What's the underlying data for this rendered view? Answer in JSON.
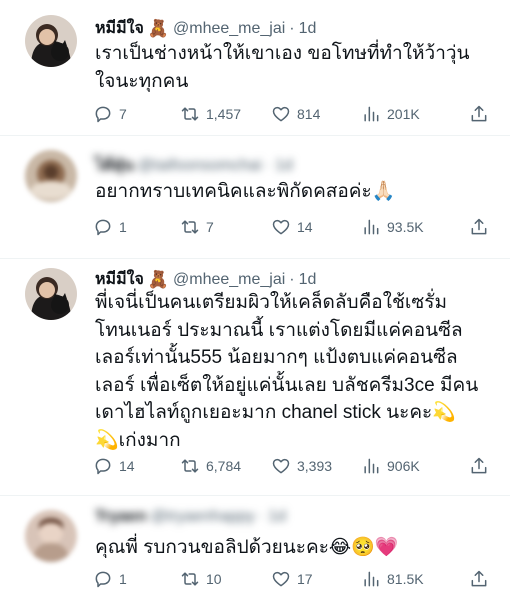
{
  "tweets": [
    {
      "name": "หมีมีใจ",
      "name_emoji": "🧸",
      "handle": "@mhee_me_jai",
      "dot": "·",
      "time": "1d",
      "lines": [
        "เราเป็นช่างหน้าให้เขาเอง ขอโทษที่ทำให้ว้าวุ่น",
        "ใจนะทุกคน"
      ],
      "replies": "7",
      "retweets": "1,457",
      "likes": "814",
      "views": "201K"
    },
    {
      "name": "ไต้ฝุ่น",
      "handle": "@taifoonsomchai",
      "dot": "·",
      "time": "1d",
      "lines": [
        "อยากทราบเทคนิคและพิกัดคสอค่ะ🙏🏻"
      ],
      "replies": "1",
      "retweets": "7",
      "likes": "14",
      "views": "93.5K"
    },
    {
      "name": "หมีมีใจ",
      "name_emoji": "🧸",
      "handle": "@mhee_me_jai",
      "dot": "·",
      "time": "1d",
      "lines": [
        "พี่เจนี่เป็นคนเตรียมผิวให้เคล็ดลับคือใช้เซรั่ม",
        "โทนเนอร์ ประมาณนี้ เราแต่งโดยมีแค่คอนซีล",
        "เลอร์เท่านั้น555 น้อยมากๆ แป้งตบแค่คอนซีล",
        "เลอร์ เพื่อเซ็ตให้อยู่แค่นั้นเลย บลัชครีม3ce มีคน",
        "เดาไฮไลท์ถูกเยอะมาก chanel stick นะคะ💫",
        "💫เก่งมาก"
      ],
      "replies": "14",
      "retweets": "6,784",
      "likes": "3,393",
      "views": "906K"
    },
    {
      "name": "Tryaen",
      "handle": "@tryaenhappy",
      "dot": "·",
      "time": "1d",
      "lines": [
        "คุณพี่ รบกวนขอลิปด้วยนะคะ😂🥺💗"
      ],
      "replies": "1",
      "retweets": "10",
      "likes": "17",
      "views": "81.5K"
    }
  ],
  "icons": {
    "reply": "reply-icon",
    "retweet": "retweet-icon",
    "like": "heart-icon",
    "views": "views-icon",
    "share": "share-icon"
  },
  "colors": {
    "text": "#0f1419",
    "secondary": "#536471",
    "divider": "#eff3f4"
  }
}
